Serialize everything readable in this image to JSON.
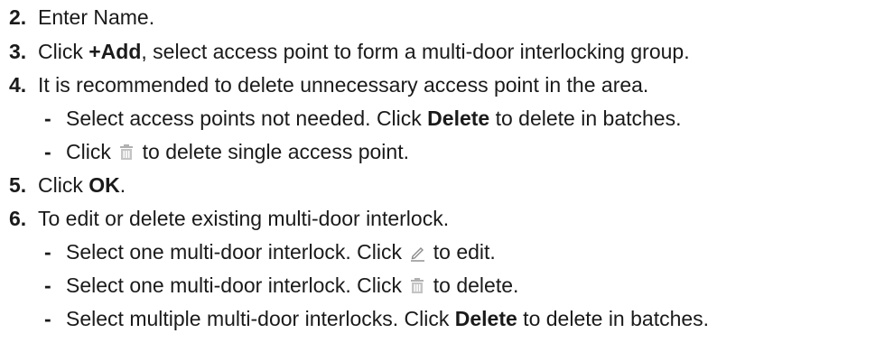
{
  "steps": [
    {
      "num": "2.",
      "text": "Enter Name."
    },
    {
      "num": "3.",
      "pre": "Click ",
      "bold": "+Add",
      "post": ", select access point to form a multi-door interlocking group."
    },
    {
      "num": "4.",
      "text": "It is recommended to delete unnecessary access point in the area."
    },
    {
      "num": "5.",
      "pre": "Click ",
      "bold": "OK",
      "post": "."
    },
    {
      "num": "6.",
      "text": "To edit or delete existing multi-door interlock."
    }
  ],
  "substeps_4": [
    {
      "dash": "-",
      "pre": "Select access points not needed. Click ",
      "bold": "Delete",
      "post": " to delete in batches."
    },
    {
      "dash": "-",
      "pre": "Click ",
      "icon": "trash-icon",
      "post": " to delete single access point."
    }
  ],
  "substeps_6": [
    {
      "dash": "-",
      "pre": "Select one multi-door interlock. Click ",
      "icon": "edit-pencil-icon",
      "post": " to edit."
    },
    {
      "dash": "-",
      "pre": "Select one multi-door interlock. Click ",
      "icon": "trash-icon",
      "post": " to delete."
    },
    {
      "dash": "-",
      "pre": "Select multiple multi-door interlocks. Click ",
      "bold": "Delete",
      "post": " to delete in batches."
    }
  ],
  "colors": {
    "text": "#1a1a1a",
    "icon": "#9a9a9a"
  }
}
